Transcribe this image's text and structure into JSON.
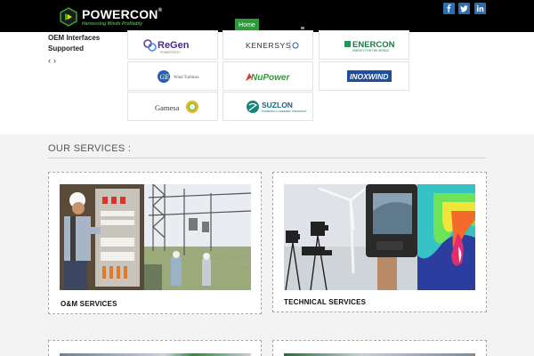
{
  "brand": {
    "name": "POWERCON",
    "reg": "®",
    "tagline": "Harnessing Winds Profitably",
    "accent": "#2e9a37"
  },
  "nav": {
    "home_label": "Home"
  },
  "social": [
    {
      "name": "facebook-icon",
      "glyph": "f"
    },
    {
      "name": "twitter-icon",
      "glyph": "t"
    },
    {
      "name": "linkedin-icon",
      "glyph": "in"
    }
  ],
  "oem": {
    "title": "OEM Interfaces Supported",
    "prev": "‹",
    "next": "›",
    "logos": [
      {
        "name": "ReGen",
        "sub": "POWERTECH"
      },
      {
        "name": "KENERSYS",
        "sub": ""
      },
      {
        "name": "ENERCON",
        "sub": "ENERGY FOR THE WORLD"
      },
      {
        "name": "Wind Turbines",
        "sub": ""
      },
      {
        "name": "NuPower",
        "sub": ""
      },
      {
        "name": "INOXWIND",
        "sub": ""
      },
      {
        "name": "Gamesa",
        "sub": ""
      },
      {
        "name": "SUZLON",
        "sub": "POWERING A GREENER TOMORROW"
      }
    ]
  },
  "services": {
    "heading": "OUR SERVICES :",
    "items": [
      {
        "label": "O&M SERVICES"
      },
      {
        "label": "TECHNICAL SERVICES"
      }
    ]
  }
}
